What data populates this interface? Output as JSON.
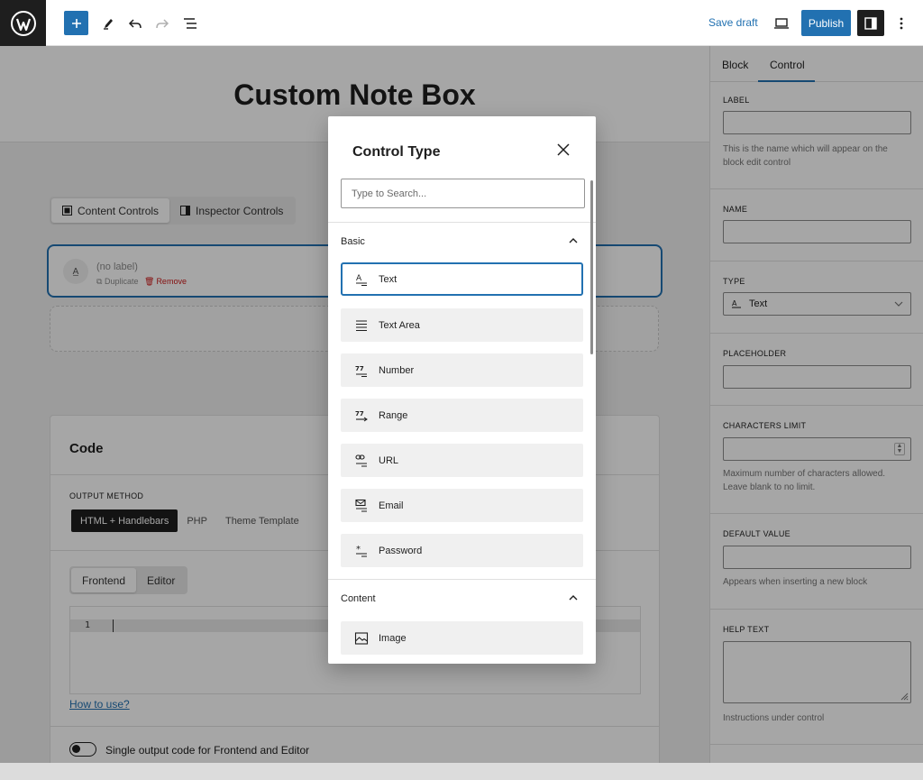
{
  "toolbar": {
    "save_draft": "Save draft",
    "publish": "Publish"
  },
  "post": {
    "title": "Custom Note Box"
  },
  "controls_tabs": {
    "content": "Content Controls",
    "inspector": "Inspector Controls"
  },
  "control_card": {
    "label": "(no label)",
    "duplicate": "Duplicate",
    "remove": "Remove"
  },
  "code": {
    "title": "Code",
    "output_method_label": "OUTPUT METHOD",
    "methods": [
      "HTML + Handlebars",
      "PHP",
      "Theme Template"
    ],
    "view_tabs": [
      "Frontend",
      "Editor"
    ],
    "line_number": "1",
    "how_to_use": "How to use?",
    "single_output_label": "Single output code for Frontend and Editor"
  },
  "sidebar": {
    "tabs": [
      "Block",
      "Control"
    ],
    "label_heading": "LABEL",
    "label_help": "This is the name which will appear on the block edit control",
    "name_heading": "NAME",
    "type_heading": "TYPE",
    "type_value": "Text",
    "placeholder_heading": "PLACEHOLDER",
    "chars_heading": "CHARACTERS LIMIT",
    "chars_help": "Maximum number of characters allowed. Leave blank to no limit.",
    "default_heading": "DEFAULT VALUE",
    "default_help": "Appears when inserting a new block",
    "help_heading": "HELP TEXT",
    "help_help": "Instructions under control"
  },
  "modal": {
    "title": "Control Type",
    "search_placeholder": "Type to Search...",
    "basic_label": "Basic",
    "basic_items": [
      "Text",
      "Text Area",
      "Number",
      "Range",
      "URL",
      "Email",
      "Password"
    ],
    "content_label": "Content",
    "content_items": [
      "Image"
    ]
  },
  "colors": {
    "accent": "#2271b1",
    "dark": "#1e1e1e",
    "danger": "#cc1818"
  }
}
